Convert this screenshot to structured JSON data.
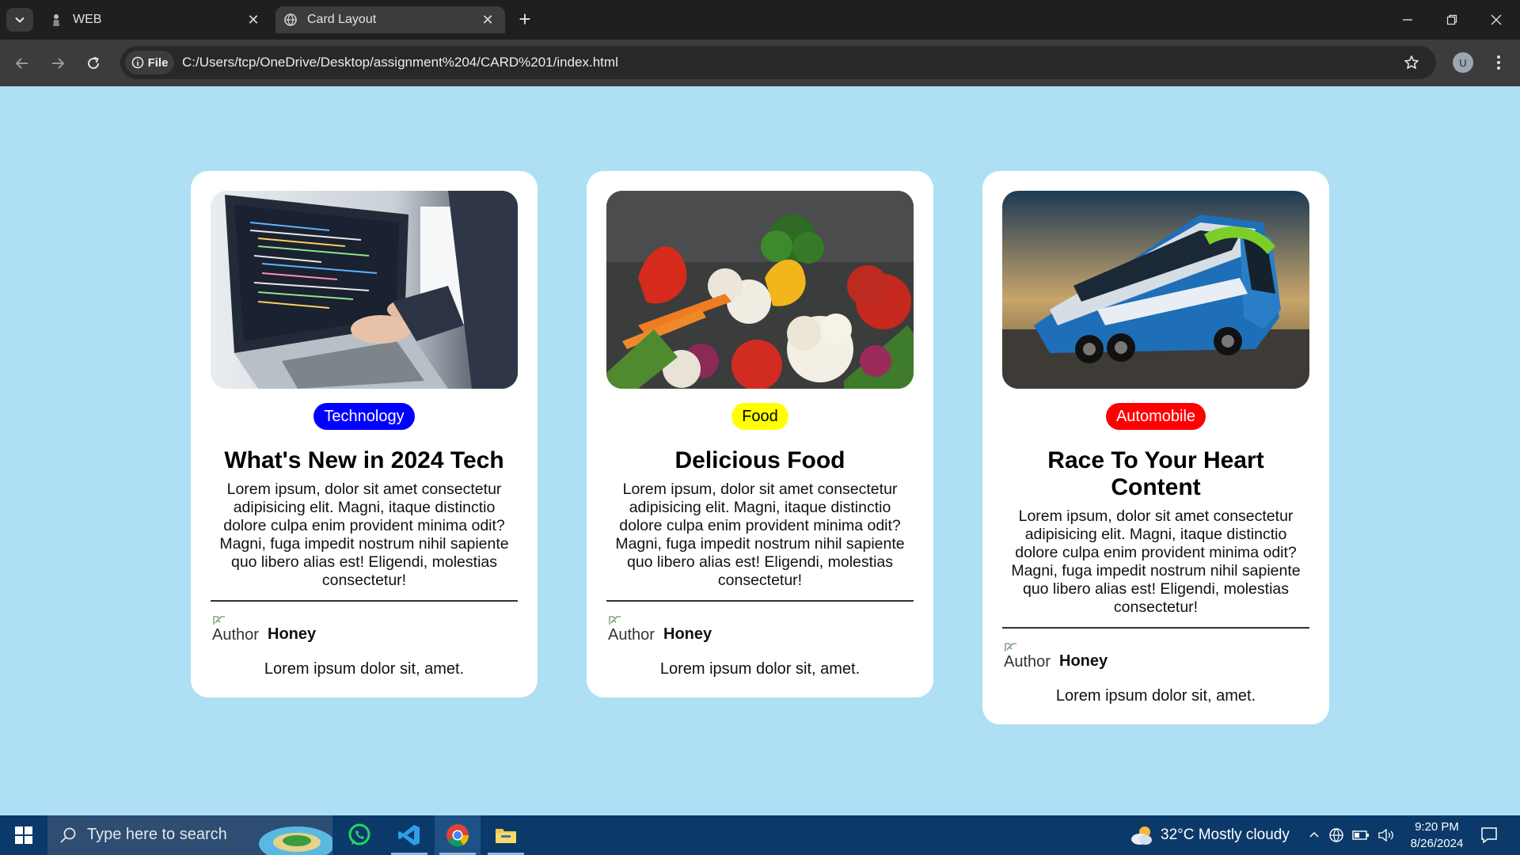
{
  "browser": {
    "tabs": [
      {
        "title": "WEB",
        "active": false,
        "favicon": "figure-icon"
      },
      {
        "title": "Card Layout",
        "active": true,
        "favicon": "globe-icon"
      }
    ],
    "address": {
      "chip_label": "File",
      "url": "C:/Users/tcp/OneDrive/Desktop/assignment%204/CARD%201/index.html"
    },
    "profile_initial": "U"
  },
  "colors": {
    "page_background": "#aedff4",
    "badge_technology": "#0000ff",
    "badge_food": "#ffff00",
    "badge_automobile": "#ff0000"
  },
  "cards": [
    {
      "image_subject": "laptop-with-code",
      "badge": "Technology",
      "title": "What's New in 2024 Tech",
      "text": "Lorem ipsum, dolor sit amet consectetur adipisicing elit. Magni, itaque distinctio dolore culpa enim provident minima odit? Magni, fuga impedit nostrum nihil sapiente quo libero alias est! Eligendi, molestias consectetur!",
      "author_alt": "Author",
      "author_name": "Honey",
      "meta": "Lorem ipsum dolor sit, amet."
    },
    {
      "image_subject": "vegetables",
      "badge": "Food",
      "title": "Delicious Food",
      "text": "Lorem ipsum, dolor sit amet consectetur adipisicing elit. Magni, itaque distinctio dolore culpa enim provident minima odit? Magni, fuga impedit nostrum nihil sapiente quo libero alias est! Eligendi, molestias consectetur!",
      "author_alt": "Author",
      "author_name": "Honey",
      "meta": "Lorem ipsum dolor sit, amet."
    },
    {
      "image_subject": "bus-on-road",
      "badge": "Automobile",
      "title": "Race To Your Heart Content",
      "text": "Lorem ipsum, dolor sit amet consectetur adipisicing elit. Magni, itaque distinctio dolore culpa enim provident minima odit? Magni, fuga impedit nostrum nihil sapiente quo libero alias est! Eligendi, molestias consectetur!",
      "author_alt": "Author",
      "author_name": "Honey",
      "meta": "Lorem ipsum dolor sit, amet."
    }
  ],
  "taskbar": {
    "search_placeholder": "Type here to search",
    "apps": [
      "whatsapp-icon",
      "vscode-icon",
      "chrome-icon",
      "file-explorer-icon"
    ],
    "weather": "32°C  Mostly cloudy",
    "time": "9:20 PM",
    "date": "8/26/2024"
  }
}
